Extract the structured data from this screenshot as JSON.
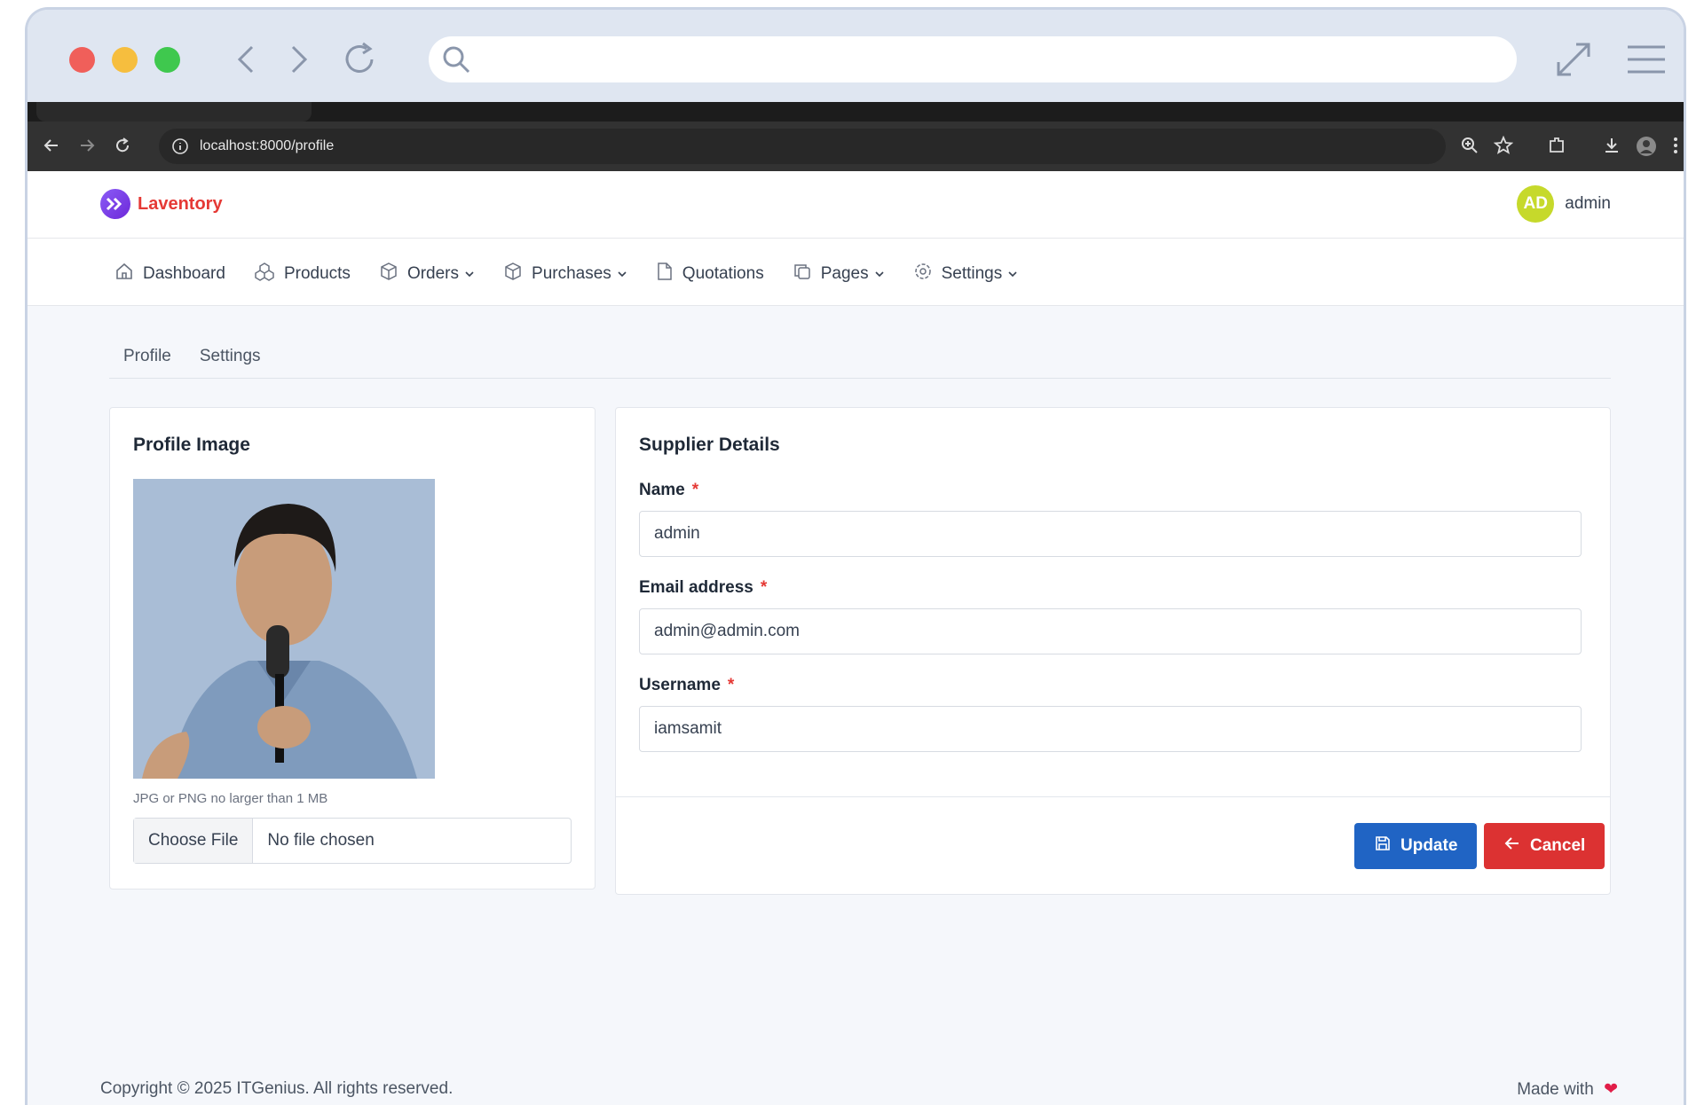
{
  "browser": {
    "url": "localhost:8000/profile"
  },
  "app": {
    "brand": "Laventory",
    "user": {
      "initials": "AD",
      "name": "admin"
    }
  },
  "nav": {
    "items": [
      {
        "label": "Dashboard",
        "icon": "home-icon",
        "dropdown": false
      },
      {
        "label": "Products",
        "icon": "boxes-icon",
        "dropdown": false
      },
      {
        "label": "Orders",
        "icon": "package-icon",
        "dropdown": true
      },
      {
        "label": "Purchases",
        "icon": "package-icon",
        "dropdown": true
      },
      {
        "label": "Quotations",
        "icon": "file-icon",
        "dropdown": false
      },
      {
        "label": "Pages",
        "icon": "copy-icon",
        "dropdown": true
      },
      {
        "label": "Settings",
        "icon": "gear-icon",
        "dropdown": true
      }
    ]
  },
  "subtabs": [
    "Profile",
    "Settings"
  ],
  "profile_image": {
    "title": "Profile Image",
    "hint": "JPG or PNG no larger than 1 MB",
    "choose_label": "Choose File",
    "file_status": "No file chosen"
  },
  "supplier": {
    "title": "Supplier Details",
    "name_label": "Name",
    "name_value": "admin",
    "email_label": "Email address",
    "email_value": "admin@admin.com",
    "username_label": "Username",
    "username_value": "iamsamit",
    "required_mark": "*",
    "update_label": "Update",
    "cancel_label": "Cancel"
  },
  "footer": {
    "copyright": "Copyright © 2025 ITGenius. All rights reserved.",
    "made_with": "Made with"
  },
  "colors": {
    "brand": "#e53935",
    "primary": "#2064c4",
    "danger": "#dc3232",
    "avatar": "#c6d92b"
  }
}
